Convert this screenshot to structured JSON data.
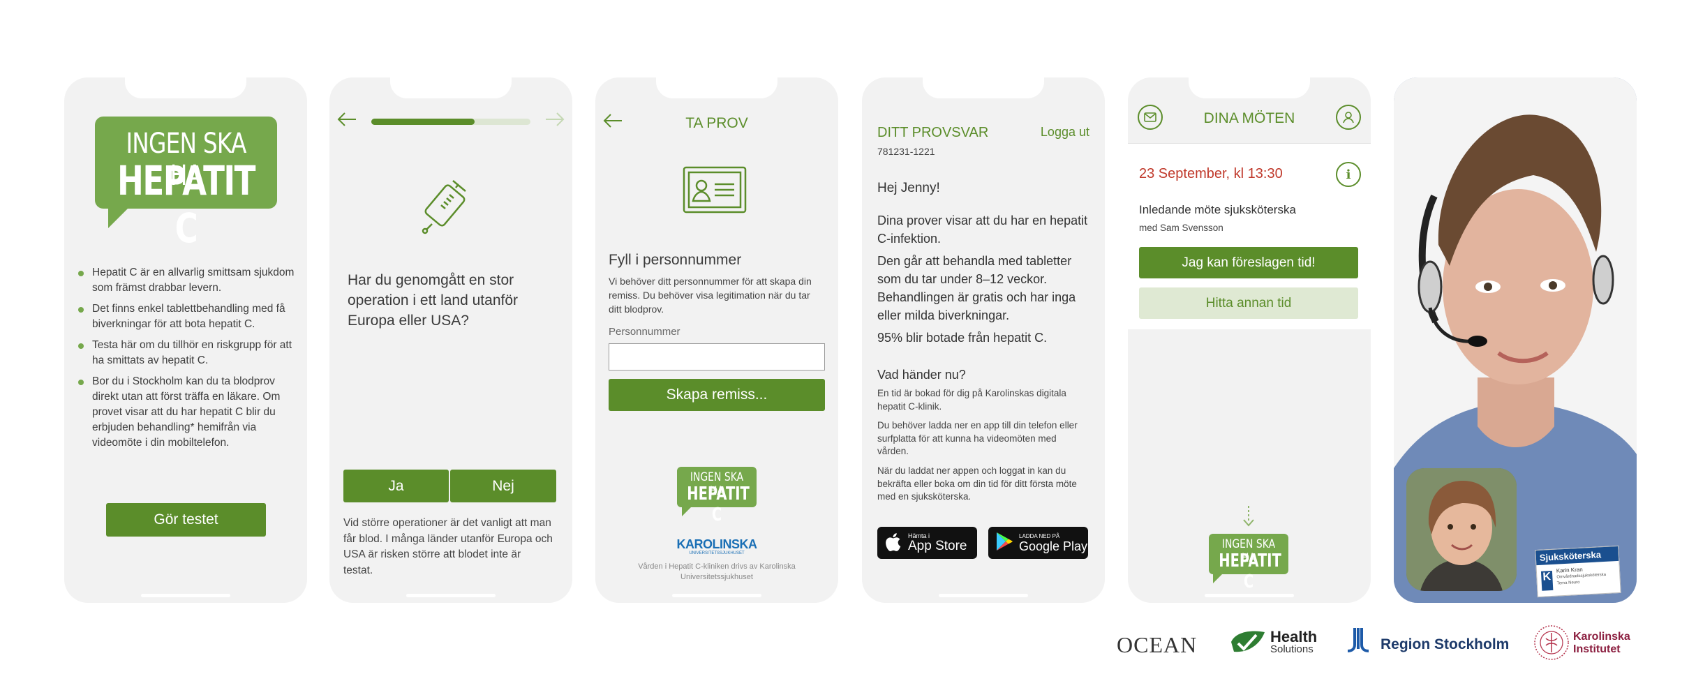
{
  "phone1": {
    "brand_line1": "INGEN SKA HA",
    "brand_line2": "HEPATIT C",
    "bullets": [
      "Hepatit C är en allvarlig smittsam sjukdom som främst drabbar levern.",
      "Det finns enkel tablettbehandling med få biverkningar för att bota hepatit C.",
      "Testa här om du tillhör en riskgrupp för att ha smittats av hepatit C.",
      "Bor du i Stockholm kan du ta blodprov direkt utan att först träffa en läkare. Om provet visar att du har hepatit C blir du erbjuden behandling* hemifrån via videomöte i din mobiltelefon."
    ],
    "cta": "Gör testet"
  },
  "phone2": {
    "progress": 0.65,
    "question": "Har du genomgått en stor operation i ett land utanför Europa eller USA?",
    "yes": "Ja",
    "no": "Nej",
    "footnote": "Vid större operationer är det vanligt att man får blod. I många länder utanför Europa och USA är risken större att blodet inte är testat.",
    "icon": "blood-test-tube-icon"
  },
  "phone3": {
    "title": "TA PROV",
    "heading": "Fyll i personnummer",
    "body": "Vi behöver ditt personnummer för att skapa din remiss. Du behöver visa legitimation när du tar ditt blodprov.",
    "field_label": "Personnummer",
    "field_value": "",
    "cta": "Skapa remiss...",
    "brand_line1": "INGEN SKA HA",
    "brand_line2": "HEPATIT C",
    "karolinska": "KAROLINSKA",
    "karolinska_sub": "UNIVERSITETSSJUKHUSET",
    "footer": "Vården i Hepatit C-kliniken drivs av Karolinska Universitetssjukhuset"
  },
  "phone4": {
    "title": "DITT PROVSVAR",
    "logout": "Logga ut",
    "id": "781231-1221",
    "greeting": "Hej Jenny!",
    "p1": "Dina prover visar att du har en hepatit C-infektion.",
    "p2": "Den går att behandla med tabletter som du tar under 8–12 veckor. Behandlingen är gratis och har inga eller milda biverkningar.",
    "p3": "95% blir botade från hepatit C.",
    "subheading": "Vad händer nu?",
    "s1": "En tid är bokad för dig på Karolinskas digitala hepatit C-klinik.",
    "s2": "Du behöver ladda ner en app till din telefon eller surfplatta för att kunna ha videomöten med vården.",
    "s3": "När du laddat ner appen och loggat in kan du bekräfta eller boka om din tid för ditt första möte med en sjuksköterska.",
    "appstore_small": "Hämta i",
    "appstore_big": "App Store",
    "gplay_small": "LADDA NED PÅ",
    "gplay_big": "Google Play"
  },
  "phone5": {
    "title": "DINA MÖTEN",
    "date": "23 September, kl 13:30",
    "meeting": "Inledande möte sjuksköterska",
    "with": "med Sam Svensson",
    "accept": "Jag kan föreslagen tid!",
    "other": "Hitta annan tid",
    "brand_line1": "INGEN SKA HA",
    "brand_line2": "HEPATIT C"
  },
  "phone6": {
    "badge_title": "Sjuksköterska",
    "badge_name": "Karin Kran",
    "badge_role": "Omvårdnadssjuksköterska",
    "badge_dept": "Tema Neuro"
  },
  "logos": {
    "ocean": "OCEAN",
    "health": "Health",
    "solutions": "Solutions",
    "region": "Region Stockholm",
    "ki1": "Karolinska",
    "ki2": "Institutet"
  },
  "colors": {
    "brand_green": "#5b8d2a",
    "light_green": "#76a84c",
    "date_red": "#c0392b",
    "background": "#f2f2f2"
  }
}
